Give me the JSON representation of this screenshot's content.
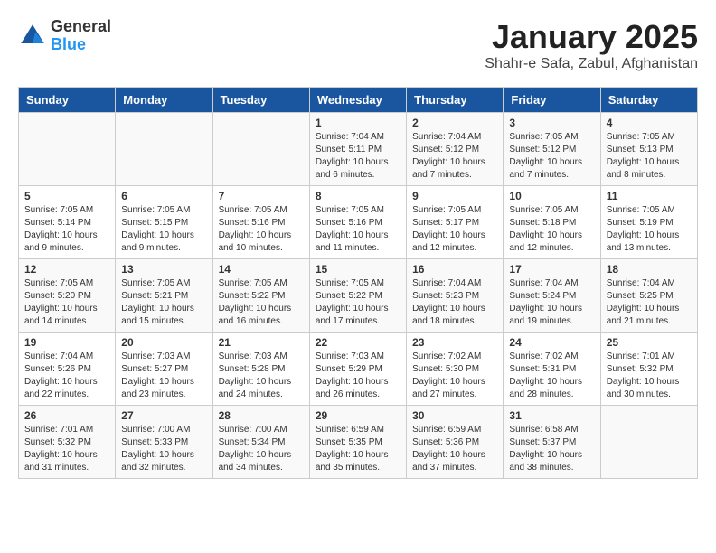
{
  "header": {
    "logo_general": "General",
    "logo_blue": "Blue",
    "title": "January 2025",
    "subtitle": "Shahr-e Safa, Zabul, Afghanistan"
  },
  "weekdays": [
    "Sunday",
    "Monday",
    "Tuesday",
    "Wednesday",
    "Thursday",
    "Friday",
    "Saturday"
  ],
  "weeks": [
    [
      {
        "day": "",
        "info": ""
      },
      {
        "day": "",
        "info": ""
      },
      {
        "day": "",
        "info": ""
      },
      {
        "day": "1",
        "info": "Sunrise: 7:04 AM\nSunset: 5:11 PM\nDaylight: 10 hours\nand 6 minutes."
      },
      {
        "day": "2",
        "info": "Sunrise: 7:04 AM\nSunset: 5:12 PM\nDaylight: 10 hours\nand 7 minutes."
      },
      {
        "day": "3",
        "info": "Sunrise: 7:05 AM\nSunset: 5:12 PM\nDaylight: 10 hours\nand 7 minutes."
      },
      {
        "day": "4",
        "info": "Sunrise: 7:05 AM\nSunset: 5:13 PM\nDaylight: 10 hours\nand 8 minutes."
      }
    ],
    [
      {
        "day": "5",
        "info": "Sunrise: 7:05 AM\nSunset: 5:14 PM\nDaylight: 10 hours\nand 9 minutes."
      },
      {
        "day": "6",
        "info": "Sunrise: 7:05 AM\nSunset: 5:15 PM\nDaylight: 10 hours\nand 9 minutes."
      },
      {
        "day": "7",
        "info": "Sunrise: 7:05 AM\nSunset: 5:16 PM\nDaylight: 10 hours\nand 10 minutes."
      },
      {
        "day": "8",
        "info": "Sunrise: 7:05 AM\nSunset: 5:16 PM\nDaylight: 10 hours\nand 11 minutes."
      },
      {
        "day": "9",
        "info": "Sunrise: 7:05 AM\nSunset: 5:17 PM\nDaylight: 10 hours\nand 12 minutes."
      },
      {
        "day": "10",
        "info": "Sunrise: 7:05 AM\nSunset: 5:18 PM\nDaylight: 10 hours\nand 12 minutes."
      },
      {
        "day": "11",
        "info": "Sunrise: 7:05 AM\nSunset: 5:19 PM\nDaylight: 10 hours\nand 13 minutes."
      }
    ],
    [
      {
        "day": "12",
        "info": "Sunrise: 7:05 AM\nSunset: 5:20 PM\nDaylight: 10 hours\nand 14 minutes."
      },
      {
        "day": "13",
        "info": "Sunrise: 7:05 AM\nSunset: 5:21 PM\nDaylight: 10 hours\nand 15 minutes."
      },
      {
        "day": "14",
        "info": "Sunrise: 7:05 AM\nSunset: 5:22 PM\nDaylight: 10 hours\nand 16 minutes."
      },
      {
        "day": "15",
        "info": "Sunrise: 7:05 AM\nSunset: 5:22 PM\nDaylight: 10 hours\nand 17 minutes."
      },
      {
        "day": "16",
        "info": "Sunrise: 7:04 AM\nSunset: 5:23 PM\nDaylight: 10 hours\nand 18 minutes."
      },
      {
        "day": "17",
        "info": "Sunrise: 7:04 AM\nSunset: 5:24 PM\nDaylight: 10 hours\nand 19 minutes."
      },
      {
        "day": "18",
        "info": "Sunrise: 7:04 AM\nSunset: 5:25 PM\nDaylight: 10 hours\nand 21 minutes."
      }
    ],
    [
      {
        "day": "19",
        "info": "Sunrise: 7:04 AM\nSunset: 5:26 PM\nDaylight: 10 hours\nand 22 minutes."
      },
      {
        "day": "20",
        "info": "Sunrise: 7:03 AM\nSunset: 5:27 PM\nDaylight: 10 hours\nand 23 minutes."
      },
      {
        "day": "21",
        "info": "Sunrise: 7:03 AM\nSunset: 5:28 PM\nDaylight: 10 hours\nand 24 minutes."
      },
      {
        "day": "22",
        "info": "Sunrise: 7:03 AM\nSunset: 5:29 PM\nDaylight: 10 hours\nand 26 minutes."
      },
      {
        "day": "23",
        "info": "Sunrise: 7:02 AM\nSunset: 5:30 PM\nDaylight: 10 hours\nand 27 minutes."
      },
      {
        "day": "24",
        "info": "Sunrise: 7:02 AM\nSunset: 5:31 PM\nDaylight: 10 hours\nand 28 minutes."
      },
      {
        "day": "25",
        "info": "Sunrise: 7:01 AM\nSunset: 5:32 PM\nDaylight: 10 hours\nand 30 minutes."
      }
    ],
    [
      {
        "day": "26",
        "info": "Sunrise: 7:01 AM\nSunset: 5:32 PM\nDaylight: 10 hours\nand 31 minutes."
      },
      {
        "day": "27",
        "info": "Sunrise: 7:00 AM\nSunset: 5:33 PM\nDaylight: 10 hours\nand 32 minutes."
      },
      {
        "day": "28",
        "info": "Sunrise: 7:00 AM\nSunset: 5:34 PM\nDaylight: 10 hours\nand 34 minutes."
      },
      {
        "day": "29",
        "info": "Sunrise: 6:59 AM\nSunset: 5:35 PM\nDaylight: 10 hours\nand 35 minutes."
      },
      {
        "day": "30",
        "info": "Sunrise: 6:59 AM\nSunset: 5:36 PM\nDaylight: 10 hours\nand 37 minutes."
      },
      {
        "day": "31",
        "info": "Sunrise: 6:58 AM\nSunset: 5:37 PM\nDaylight: 10 hours\nand 38 minutes."
      },
      {
        "day": "",
        "info": ""
      }
    ]
  ]
}
